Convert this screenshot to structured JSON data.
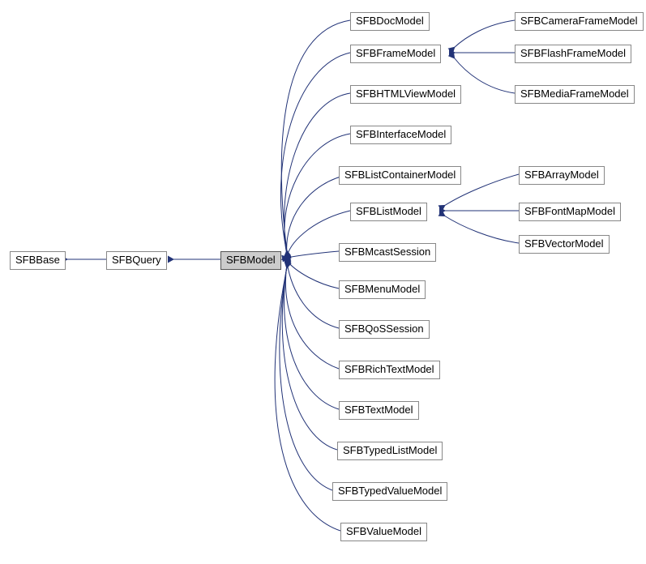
{
  "chart_data": {
    "type": "hierarchy",
    "title": "",
    "focal_node": "SFBModel",
    "edges": [
      {
        "from": "SFBQuery",
        "to": "SFBBase"
      },
      {
        "from": "SFBModel",
        "to": "SFBQuery"
      },
      {
        "from": "SFBDocModel",
        "to": "SFBModel"
      },
      {
        "from": "SFBFrameModel",
        "to": "SFBModel"
      },
      {
        "from": "SFBHTMLViewModel",
        "to": "SFBModel"
      },
      {
        "from": "SFBInterfaceModel",
        "to": "SFBModel"
      },
      {
        "from": "SFBListContainerModel",
        "to": "SFBModel"
      },
      {
        "from": "SFBListModel",
        "to": "SFBModel"
      },
      {
        "from": "SFBMcastSession",
        "to": "SFBModel"
      },
      {
        "from": "SFBMenuModel",
        "to": "SFBModel"
      },
      {
        "from": "SFBQoSSession",
        "to": "SFBModel"
      },
      {
        "from": "SFBRichTextModel",
        "to": "SFBModel"
      },
      {
        "from": "SFBTextModel",
        "to": "SFBModel"
      },
      {
        "from": "SFBTypedListModel",
        "to": "SFBModel"
      },
      {
        "from": "SFBTypedValueModel",
        "to": "SFBModel"
      },
      {
        "from": "SFBValueModel",
        "to": "SFBModel"
      },
      {
        "from": "SFBCameraFrameModel",
        "to": "SFBFrameModel"
      },
      {
        "from": "SFBFlashFrameModel",
        "to": "SFBFrameModel"
      },
      {
        "from": "SFBMediaFrameModel",
        "to": "SFBFrameModel"
      },
      {
        "from": "SFBArrayModel",
        "to": "SFBListModel"
      },
      {
        "from": "SFBFontMapModel",
        "to": "SFBListModel"
      },
      {
        "from": "SFBVectorModel",
        "to": "SFBListModel"
      }
    ]
  },
  "nodes": {
    "SFBBase": "SFBBase",
    "SFBQuery": "SFBQuery",
    "SFBModel": "SFBModel",
    "SFBDocModel": "SFBDocModel",
    "SFBFrameModel": "SFBFrameModel",
    "SFBHTMLViewModel": "SFBHTMLViewModel",
    "SFBInterfaceModel": "SFBInterfaceModel",
    "SFBListContainerModel": "SFBListContainerModel",
    "SFBListModel": "SFBListModel",
    "SFBMcastSession": "SFBMcastSession",
    "SFBMenuModel": "SFBMenuModel",
    "SFBQoSSession": "SFBQoSSession",
    "SFBRichTextModel": "SFBRichTextModel",
    "SFBTextModel": "SFBTextModel",
    "SFBTypedListModel": "SFBTypedListModel",
    "SFBTypedValueModel": "SFBTypedValueModel",
    "SFBValueModel": "SFBValueModel",
    "SFBCameraFrameModel": "SFBCameraFrameModel",
    "SFBFlashFrameModel": "SFBFlashFrameModel",
    "SFBMediaFrameModel": "SFBMediaFrameModel",
    "SFBArrayModel": "SFBArrayModel",
    "SFBFontMapModel": "SFBFontMapModel",
    "SFBVectorModel": "SFBVectorModel"
  }
}
